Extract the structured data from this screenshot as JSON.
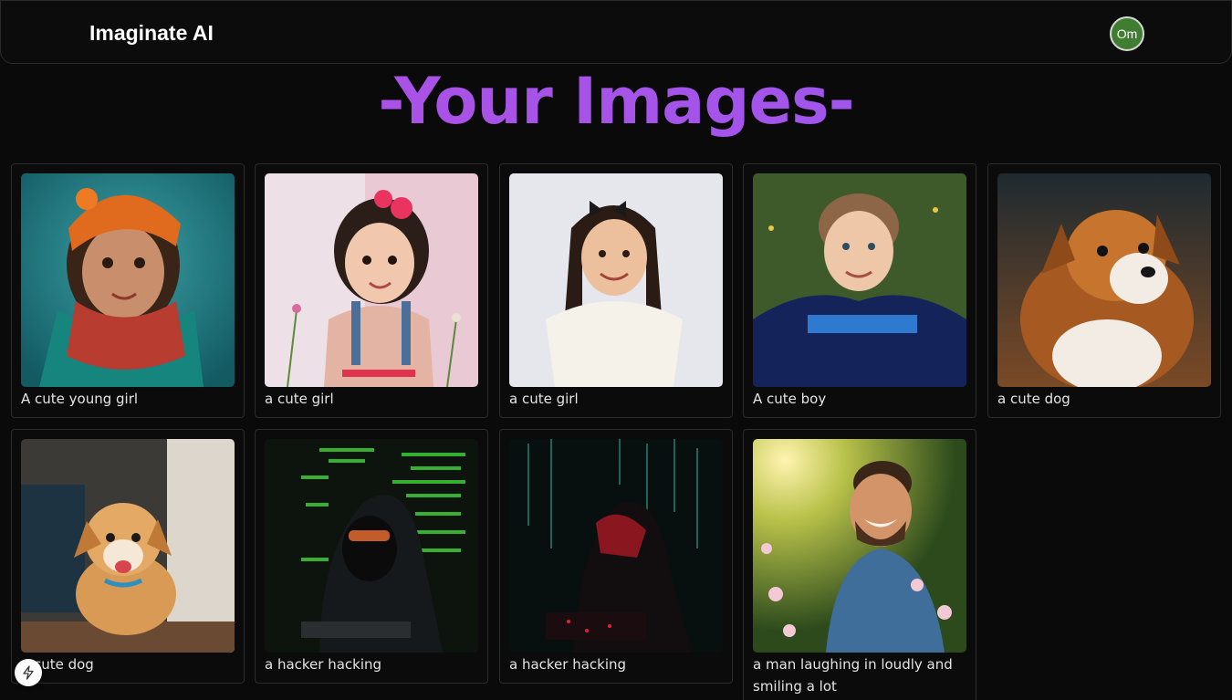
{
  "app": {
    "brand": "Imaginate AI",
    "user_initials": "Om"
  },
  "page": {
    "title": "-Your Images-"
  },
  "images": [
    {
      "caption": "A cute young girl"
    },
    {
      "caption": "a cute girl"
    },
    {
      "caption": "a cute girl"
    },
    {
      "caption": "A cute boy"
    },
    {
      "caption": "a cute dog"
    },
    {
      "caption": "a cute dog"
    },
    {
      "caption": "a hacker hacking"
    },
    {
      "caption": "a hacker hacking"
    },
    {
      "caption": "a man laughing in loudly and smiling a lot"
    }
  ],
  "colors": {
    "background": "#0a0a0a",
    "title_gradient_start": "#b24fe3",
    "title_gradient_end": "#9a58ee",
    "avatar": "#3f7d30"
  },
  "icons": {
    "floating_button": "lightning-bolt-icon"
  }
}
